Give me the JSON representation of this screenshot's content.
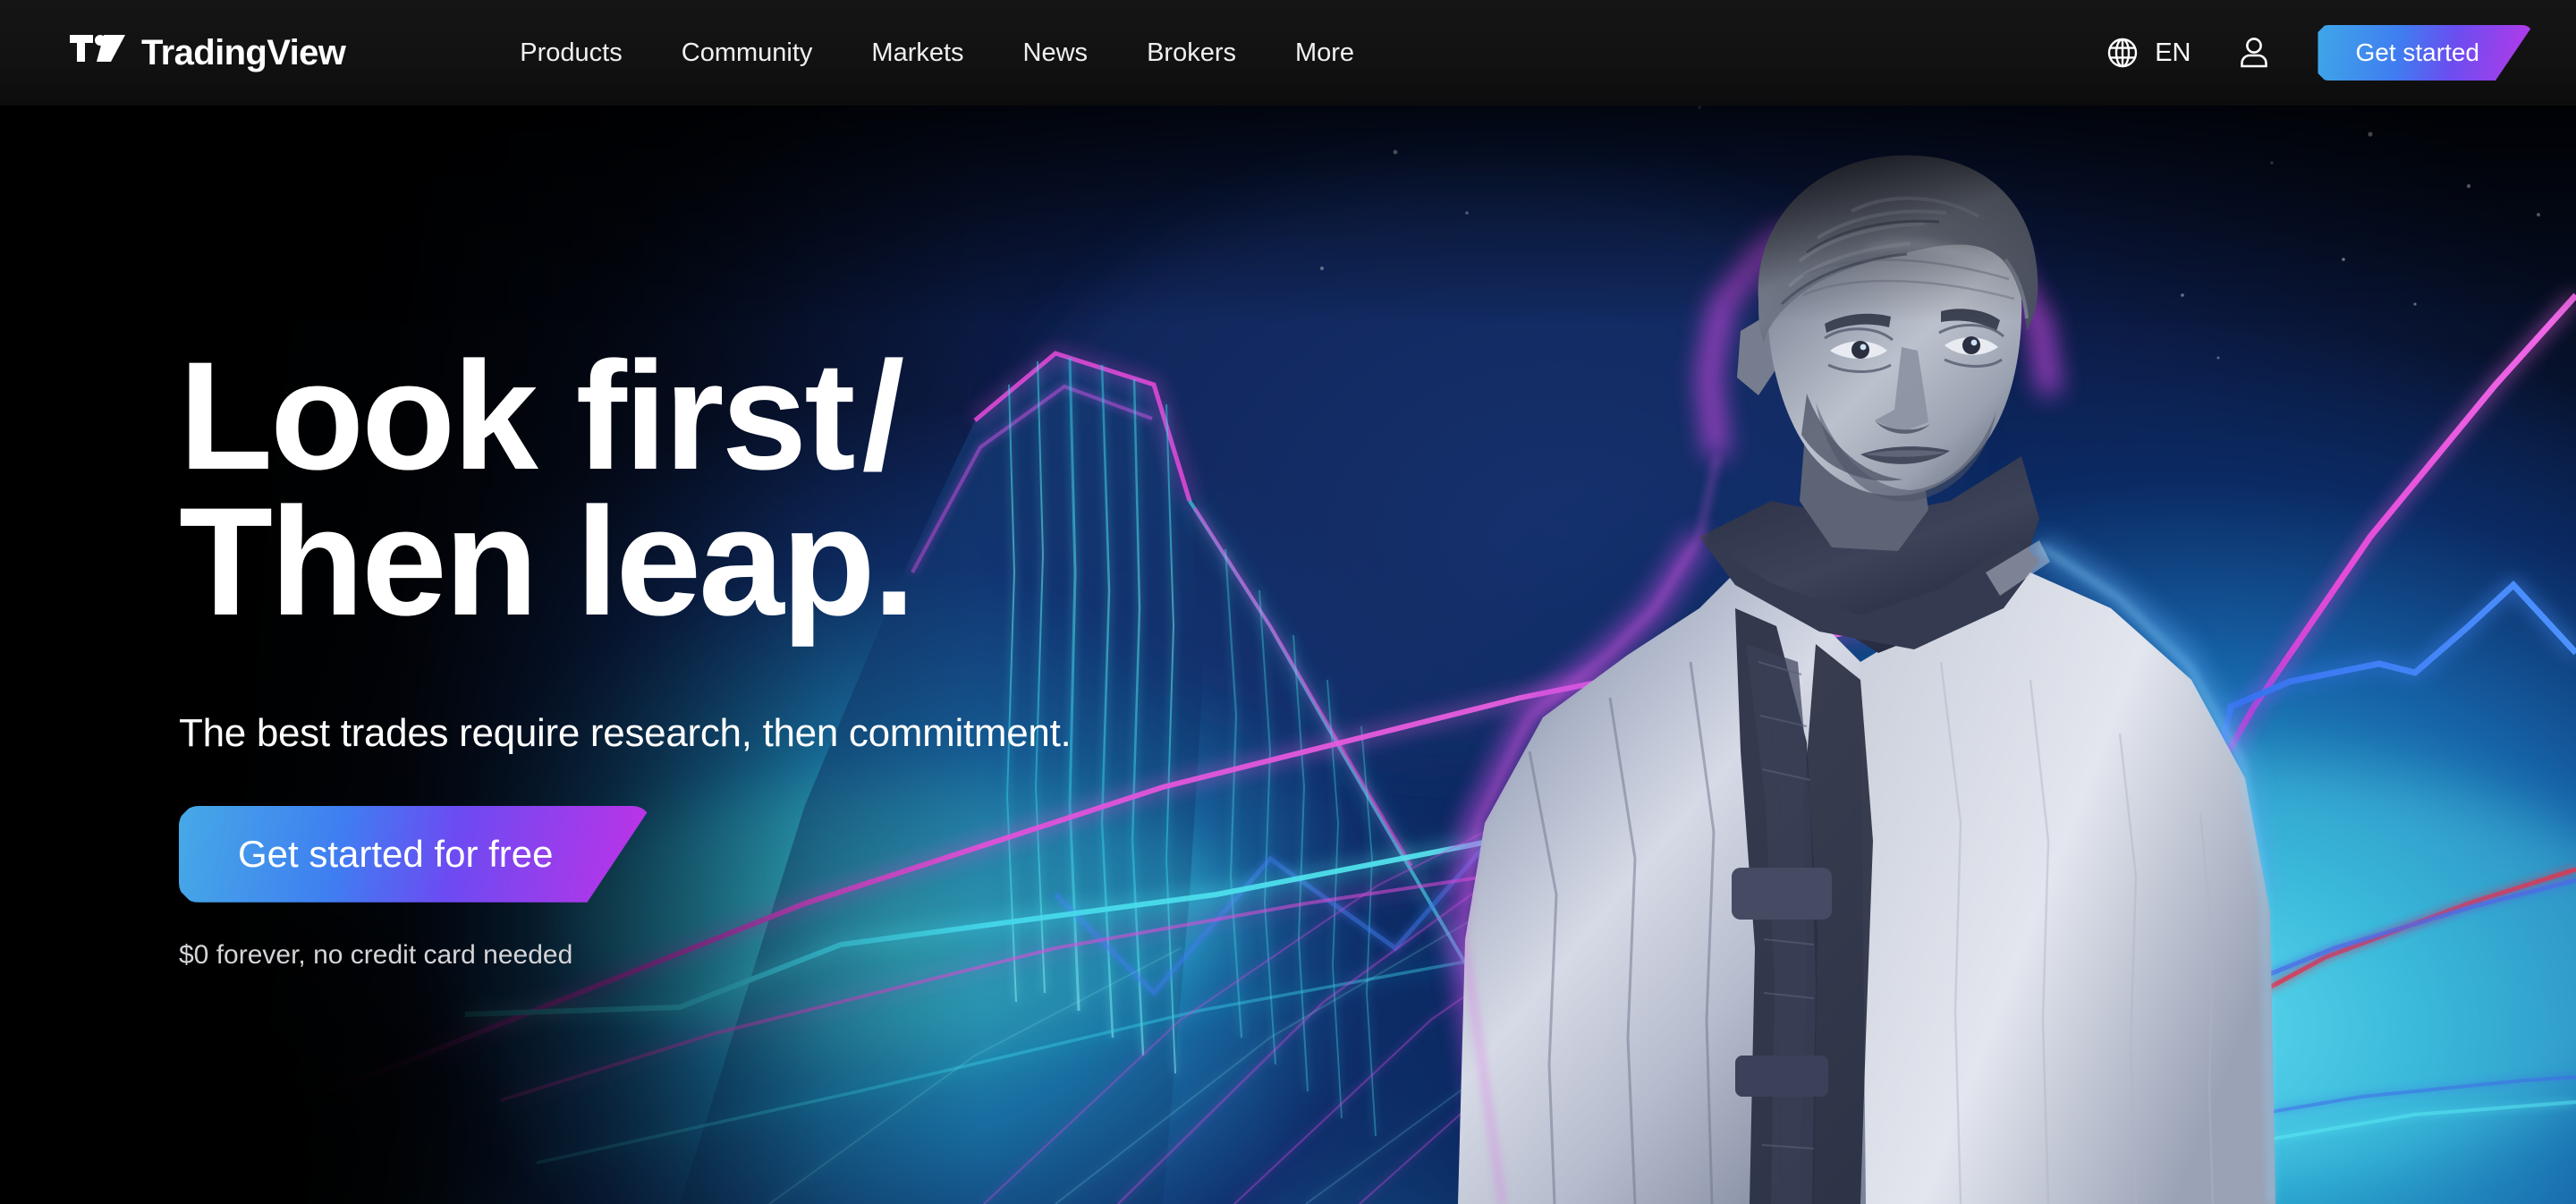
{
  "header": {
    "logo": {
      "text": "TradingView",
      "icon": "tradingview-logo-mark"
    },
    "nav": [
      {
        "label": "Products"
      },
      {
        "label": "Community"
      },
      {
        "label": "Markets"
      },
      {
        "label": "News"
      },
      {
        "label": "Brokers"
      },
      {
        "label": "More"
      }
    ],
    "language": {
      "label": "EN",
      "icon": "globe-icon"
    },
    "account": {
      "icon": "user-icon"
    },
    "get_started_label": "Get started"
  },
  "hero": {
    "headline_line1": "Look first",
    "headline_slash": "/",
    "headline_line2": "Then leap.",
    "subhead": "The best trades require research, then commitment.",
    "cta_label": "Get started for free",
    "fineprint": "$0 forever, no credit card needed"
  },
  "colors": {
    "header_bg": "#131313",
    "page_bg": "#000000",
    "text_primary": "#ffffff",
    "text_muted": "#d4d4d8",
    "gradient_start": "#3fa7e8",
    "gradient_mid": "#6a4ef0",
    "gradient_end": "#c132e6",
    "neon_cyan": "#35e4ec",
    "neon_magenta": "#e24ad8",
    "neon_blue": "#3f7df0",
    "neon_red": "#e0384f",
    "deep_blue": "#0a1c45"
  }
}
